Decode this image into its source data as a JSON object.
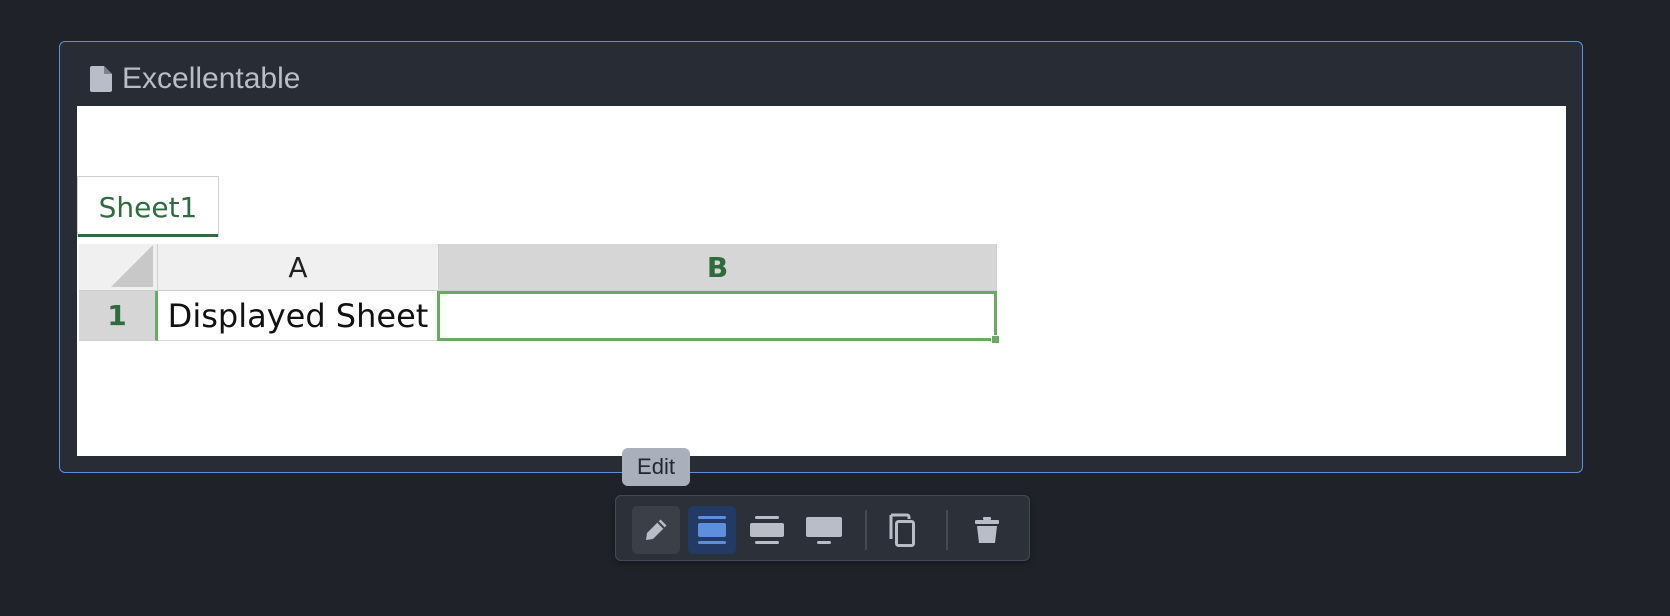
{
  "block": {
    "title": "Excellentable",
    "icon": "document-icon"
  },
  "spreadsheet": {
    "tabs": [
      {
        "label": "Sheet1",
        "active": true
      }
    ],
    "columns": [
      {
        "label": "A",
        "selected": false
      },
      {
        "label": "B",
        "selected": true
      }
    ],
    "rows": [
      {
        "label": "1",
        "cells": [
          "Displayed Sheet",
          ""
        ]
      }
    ],
    "active_cell": "B1"
  },
  "tooltip": {
    "text": "Edit"
  },
  "toolbar": {
    "buttons": [
      {
        "name": "edit-button",
        "icon": "pencil-icon",
        "state": "hovered"
      },
      {
        "name": "fixed-width-button",
        "icon": "fixed-width-icon",
        "state": "active"
      },
      {
        "name": "wide-width-button",
        "icon": "wide-width-icon",
        "state": "normal"
      },
      {
        "name": "full-width-button",
        "icon": "full-width-icon",
        "state": "normal"
      },
      {
        "name": "copy-button",
        "icon": "copy-icon",
        "state": "normal"
      },
      {
        "name": "delete-button",
        "icon": "trash-icon",
        "state": "normal"
      }
    ]
  },
  "colors": {
    "background": "#1f2228",
    "block_bg": "#282c34",
    "block_border": "#5d8fdc",
    "accent_green": "#2f6b3e",
    "selection_green": "#6aaa64",
    "active_button_bg": "#223a64",
    "active_icon": "#5d8fdc"
  }
}
